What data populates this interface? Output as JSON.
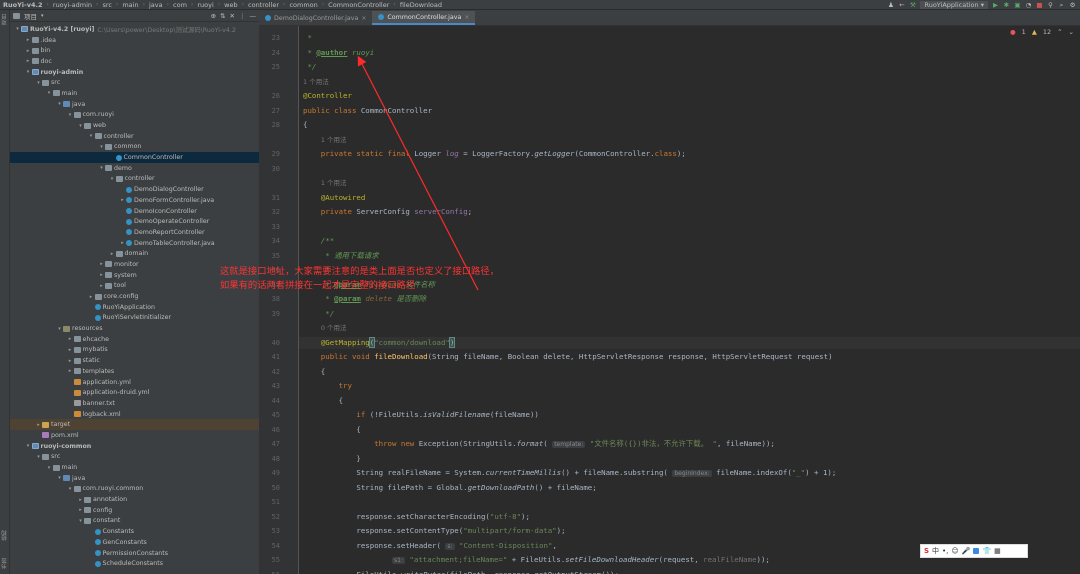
{
  "topbar": {
    "crumbs": [
      "RuoYi-v4.2",
      "ruoyi-admin",
      "src",
      "main",
      "java",
      "com",
      "ruoyi",
      "web",
      "controller",
      "common",
      "CommonController",
      "fileDownload"
    ],
    "run_config": "RuoYiApplication"
  },
  "sidestrip": {
    "project_label": "项目",
    "bottom_label": "结构",
    "bottom_label2": "书签"
  },
  "project_panel": {
    "header_label": "项目",
    "tree": [
      {
        "text": "RuoYi-v4.2 [ruoyi]",
        "extra": "C:\\Users\\power\\Desktop\\测试源码\\RuoYi-v4.2",
        "indent": 0,
        "open": true,
        "icon": "mod",
        "bold": true
      },
      {
        "text": ".idea",
        "indent": 1,
        "open": false,
        "icon": "folder"
      },
      {
        "text": "bin",
        "indent": 1,
        "open": false,
        "icon": "folder"
      },
      {
        "text": "doc",
        "indent": 1,
        "open": false,
        "icon": "folder"
      },
      {
        "text": "ruoyi-admin",
        "indent": 1,
        "open": true,
        "icon": "mod",
        "bold": true
      },
      {
        "text": "src",
        "indent": 2,
        "open": true,
        "icon": "folder"
      },
      {
        "text": "main",
        "indent": 3,
        "open": true,
        "icon": "folder"
      },
      {
        "text": "java",
        "indent": 4,
        "open": true,
        "icon": "jfolder"
      },
      {
        "text": "com.ruoyi",
        "indent": 5,
        "open": true,
        "icon": "folder"
      },
      {
        "text": "web",
        "indent": 6,
        "open": true,
        "icon": "folder"
      },
      {
        "text": "controller",
        "indent": 7,
        "open": true,
        "icon": "folder"
      },
      {
        "text": "common",
        "indent": 8,
        "open": true,
        "icon": "folder"
      },
      {
        "text": "CommonController",
        "indent": 9,
        "icon": "cls",
        "selected": true
      },
      {
        "text": "demo",
        "indent": 8,
        "open": true,
        "icon": "folder"
      },
      {
        "text": "controller",
        "indent": 9,
        "open": true,
        "icon": "folder"
      },
      {
        "text": "DemoDialogController",
        "indent": 10,
        "icon": "cls"
      },
      {
        "text": "DemoFormController.java",
        "indent": 10,
        "open": false,
        "icon": "cls"
      },
      {
        "text": "DemoIconController",
        "indent": 10,
        "icon": "cls"
      },
      {
        "text": "DemoOperateController",
        "indent": 10,
        "icon": "cls"
      },
      {
        "text": "DemoReportController",
        "indent": 10,
        "icon": "cls"
      },
      {
        "text": "DemoTableController.java",
        "indent": 10,
        "open": false,
        "icon": "cls"
      },
      {
        "text": "domain",
        "indent": 9,
        "open": false,
        "icon": "folder"
      },
      {
        "text": "monitor",
        "indent": 8,
        "open": false,
        "icon": "folder"
      },
      {
        "text": "system",
        "indent": 8,
        "open": false,
        "icon": "folder"
      },
      {
        "text": "tool",
        "indent": 8,
        "open": false,
        "icon": "folder"
      },
      {
        "text": "core.config",
        "indent": 7,
        "open": false,
        "icon": "folder"
      },
      {
        "text": "RuoYiApplication",
        "indent": 7,
        "icon": "cls"
      },
      {
        "text": "RuoYiServletInitializer",
        "indent": 7,
        "icon": "cls"
      },
      {
        "text": "resources",
        "indent": 4,
        "open": true,
        "icon": "resf"
      },
      {
        "text": "ehcache",
        "indent": 5,
        "open": false,
        "icon": "folder"
      },
      {
        "text": "mybatis",
        "indent": 5,
        "open": false,
        "icon": "folder"
      },
      {
        "text": "static",
        "indent": 5,
        "open": false,
        "icon": "folder"
      },
      {
        "text": "templates",
        "indent": 5,
        "open": false,
        "icon": "folder"
      },
      {
        "text": "application.yml",
        "indent": 5,
        "icon": "yml"
      },
      {
        "text": "application-druid.yml",
        "indent": 5,
        "icon": "yml"
      },
      {
        "text": "banner.txt",
        "indent": 5,
        "icon": "txt"
      },
      {
        "text": "logback.xml",
        "indent": 5,
        "icon": "xml"
      },
      {
        "text": "target",
        "indent": 2,
        "open": false,
        "icon": "targ",
        "hl": true
      },
      {
        "text": "pom.xml",
        "indent": 2,
        "icon": "pom"
      },
      {
        "text": "ruoyi-common",
        "indent": 1,
        "open": true,
        "icon": "mod",
        "bold": true
      },
      {
        "text": "src",
        "indent": 2,
        "open": true,
        "icon": "folder"
      },
      {
        "text": "main",
        "indent": 3,
        "open": true,
        "icon": "folder"
      },
      {
        "text": "java",
        "indent": 4,
        "open": true,
        "icon": "jfolder"
      },
      {
        "text": "com.ruoyi.common",
        "indent": 5,
        "open": true,
        "icon": "folder"
      },
      {
        "text": "annotation",
        "indent": 6,
        "open": false,
        "icon": "folder"
      },
      {
        "text": "config",
        "indent": 6,
        "open": false,
        "icon": "folder"
      },
      {
        "text": "constant",
        "indent": 6,
        "open": true,
        "icon": "folder"
      },
      {
        "text": "Constants",
        "indent": 7,
        "icon": "cls"
      },
      {
        "text": "GenConstants",
        "indent": 7,
        "icon": "cls"
      },
      {
        "text": "PermissionConstants",
        "indent": 7,
        "icon": "cls"
      },
      {
        "text": "ScheduleConstants",
        "indent": 7,
        "icon": "cls"
      }
    ]
  },
  "tabs": [
    {
      "label": "DemoDialogController.java",
      "active": false
    },
    {
      "label": "CommonController.java",
      "active": true
    }
  ],
  "inspections": {
    "errors": "1",
    "warnings": "12"
  },
  "code_lines": [
    {
      "n": "23",
      "h": [
        [
          "cm",
          " *"
        ]
      ]
    },
    {
      "n": "24",
      "h": [
        [
          "cm",
          " * "
        ],
        [
          "tag",
          "@author"
        ],
        [
          "cm",
          " ruoyi"
        ]
      ]
    },
    {
      "n": "25",
      "h": [
        [
          "cm",
          " */"
        ]
      ]
    },
    {
      "n": "",
      "hint": "1 个用法"
    },
    {
      "n": "26",
      "h": [
        [
          "an",
          "@Controller"
        ]
      ]
    },
    {
      "n": "27",
      "h": [
        [
          "kw",
          "public class "
        ],
        [
          "",
          "CommonController"
        ]
      ]
    },
    {
      "n": "28",
      "h": [
        [
          "",
          "{"
        ]
      ]
    },
    {
      "n": "",
      "hint": "1 个用法",
      "ind": "    "
    },
    {
      "n": "29",
      "h": [
        [
          "kw",
          "    private static final "
        ],
        [
          "",
          "Logger "
        ],
        [
          "fld-i",
          "log"
        ],
        [
          "",
          " = LoggerFactory."
        ],
        [
          "sm",
          "getLogger"
        ],
        [
          "",
          "(CommonController."
        ],
        [
          "kw",
          "class"
        ],
        [
          "",
          ");"
        ]
      ]
    },
    {
      "n": "30",
      "h": [
        [
          "",
          ""
        ]
      ]
    },
    {
      "n": "",
      "hint": "1 个用法",
      "ind": "    "
    },
    {
      "n": "31",
      "h": [
        [
          "",
          "    "
        ],
        [
          "an",
          "@Autowired"
        ]
      ]
    },
    {
      "n": "32",
      "h": [
        [
          "kw",
          "    private "
        ],
        [
          "",
          "ServerConfig "
        ],
        [
          "fld",
          "serverConfig"
        ],
        [
          "",
          ";"
        ]
      ]
    },
    {
      "n": "33",
      "h": [
        [
          "",
          ""
        ]
      ]
    },
    {
      "n": "34",
      "h": [
        [
          "cm",
          "    /**"
        ]
      ]
    },
    {
      "n": "35",
      "h": [
        [
          "cm",
          "     * 通用下载请求"
        ]
      ]
    },
    {
      "n": "36",
      "h": [
        [
          "cm",
          "     *"
        ]
      ]
    },
    {
      "n": "37",
      "h": [
        [
          "cm",
          "     * "
        ],
        [
          "tag",
          "@param"
        ],
        [
          "cm",
          " "
        ],
        [
          "tagp",
          "fileName"
        ],
        [
          "cm",
          " 文件名称"
        ]
      ]
    },
    {
      "n": "38",
      "h": [
        [
          "cm",
          "     * "
        ],
        [
          "tag",
          "@param"
        ],
        [
          "cm",
          " "
        ],
        [
          "tagp",
          "delete"
        ],
        [
          "cm",
          " 是否删除"
        ]
      ]
    },
    {
      "n": "39",
      "h": [
        [
          "cm",
          "     */"
        ]
      ]
    },
    {
      "n": "",
      "hint": "0 个用法",
      "ind": "    "
    },
    {
      "n": "40",
      "h": [
        [
          "",
          "    "
        ],
        [
          "an",
          "@GetMapping"
        ],
        [
          "brk",
          "("
        ],
        [
          "str",
          "\"common/download\""
        ],
        [
          "brk",
          ")"
        ]
      ],
      "cur": true
    },
    {
      "n": "41",
      "h": [
        [
          "kw",
          "    public void "
        ],
        [
          "mt",
          "fileDownload"
        ],
        [
          "",
          "(String fileName, Boolean delete, HttpServletResponse response, HttpServletRequest request)"
        ]
      ]
    },
    {
      "n": "42",
      "h": [
        [
          "",
          "    {"
        ]
      ]
    },
    {
      "n": "43",
      "h": [
        [
          "kw",
          "        try"
        ]
      ]
    },
    {
      "n": "44",
      "h": [
        [
          "",
          "        {"
        ]
      ]
    },
    {
      "n": "45",
      "h": [
        [
          "kw",
          "            if "
        ],
        [
          "",
          "(!FileUtils."
        ],
        [
          "sm",
          "isValidFilename"
        ],
        [
          "",
          "(fileName))"
        ]
      ]
    },
    {
      "n": "46",
      "h": [
        [
          "",
          "            {"
        ]
      ]
    },
    {
      "n": "47",
      "h": [
        [
          "kw",
          "                throw new "
        ],
        [
          "",
          "Exception(StringUtils."
        ],
        [
          "sm",
          "format"
        ],
        [
          "",
          "( "
        ],
        [
          "pill",
          "template:"
        ],
        [
          "str",
          " \"文件名称({})非法，不允许下载。 \""
        ],
        [
          "",
          ", fileName));"
        ]
      ]
    },
    {
      "n": "48",
      "h": [
        [
          "",
          "            }"
        ]
      ]
    },
    {
      "n": "49",
      "h": [
        [
          "",
          "            String realFileName = System."
        ],
        [
          "sm",
          "currentTimeMillis"
        ],
        [
          "",
          "() + fileName.substring( "
        ],
        [
          "pill",
          "beginIndex:"
        ],
        [
          "",
          " fileName.indexOf("
        ],
        [
          "str",
          "\"_\""
        ],
        [
          "",
          ") + "
        ],
        [
          "",
          "1"
        ],
        [
          "",
          ");"
        ]
      ]
    },
    {
      "n": "50",
      "h": [
        [
          "",
          "            String filePath = Global."
        ],
        [
          "sm",
          "getDownloadPath"
        ],
        [
          "",
          "() + fileName;"
        ]
      ]
    },
    {
      "n": "51",
      "h": [
        [
          "",
          ""
        ]
      ]
    },
    {
      "n": "52",
      "h": [
        [
          "",
          "            response.setCharacterEncoding("
        ],
        [
          "str",
          "\"utf-8\""
        ],
        [
          "",
          ");"
        ]
      ]
    },
    {
      "n": "53",
      "h": [
        [
          "",
          "            response.setContentType("
        ],
        [
          "str",
          "\"multipart/form-data\""
        ],
        [
          "",
          ");"
        ]
      ]
    },
    {
      "n": "54",
      "h": [
        [
          "",
          "            response.setHeader( "
        ],
        [
          "pill",
          "s:"
        ],
        [
          "str",
          " \"Content-Disposition\""
        ],
        [
          "",
          ","
        ]
      ]
    },
    {
      "n": "55",
      "h": [
        [
          "",
          "                    "
        ],
        [
          "pill",
          "s1:"
        ],
        [
          "str",
          " \"attachment;fileName=\""
        ],
        [
          "",
          " + FileUtils."
        ],
        [
          "sm",
          "setFileDownloadHeader"
        ],
        [
          "",
          "(request, "
        ],
        [
          "unu",
          "realFileName"
        ],
        [
          "",
          "));"
        ]
      ]
    },
    {
      "n": "56",
      "h": [
        [
          "",
          "            FileUtils."
        ],
        [
          "sm",
          "writeBytes"
        ],
        [
          "",
          "(filePath, response.getOutputStream());"
        ]
      ]
    }
  ],
  "annotation": {
    "line1": "这就是接口地址，大家需要注意的是类上面是否也定义了接口路径，",
    "line2": "如果有的话两者拼接在一起才是完整的接口路径",
    "color": "#ff3333"
  },
  "ime": {
    "label": "中"
  }
}
